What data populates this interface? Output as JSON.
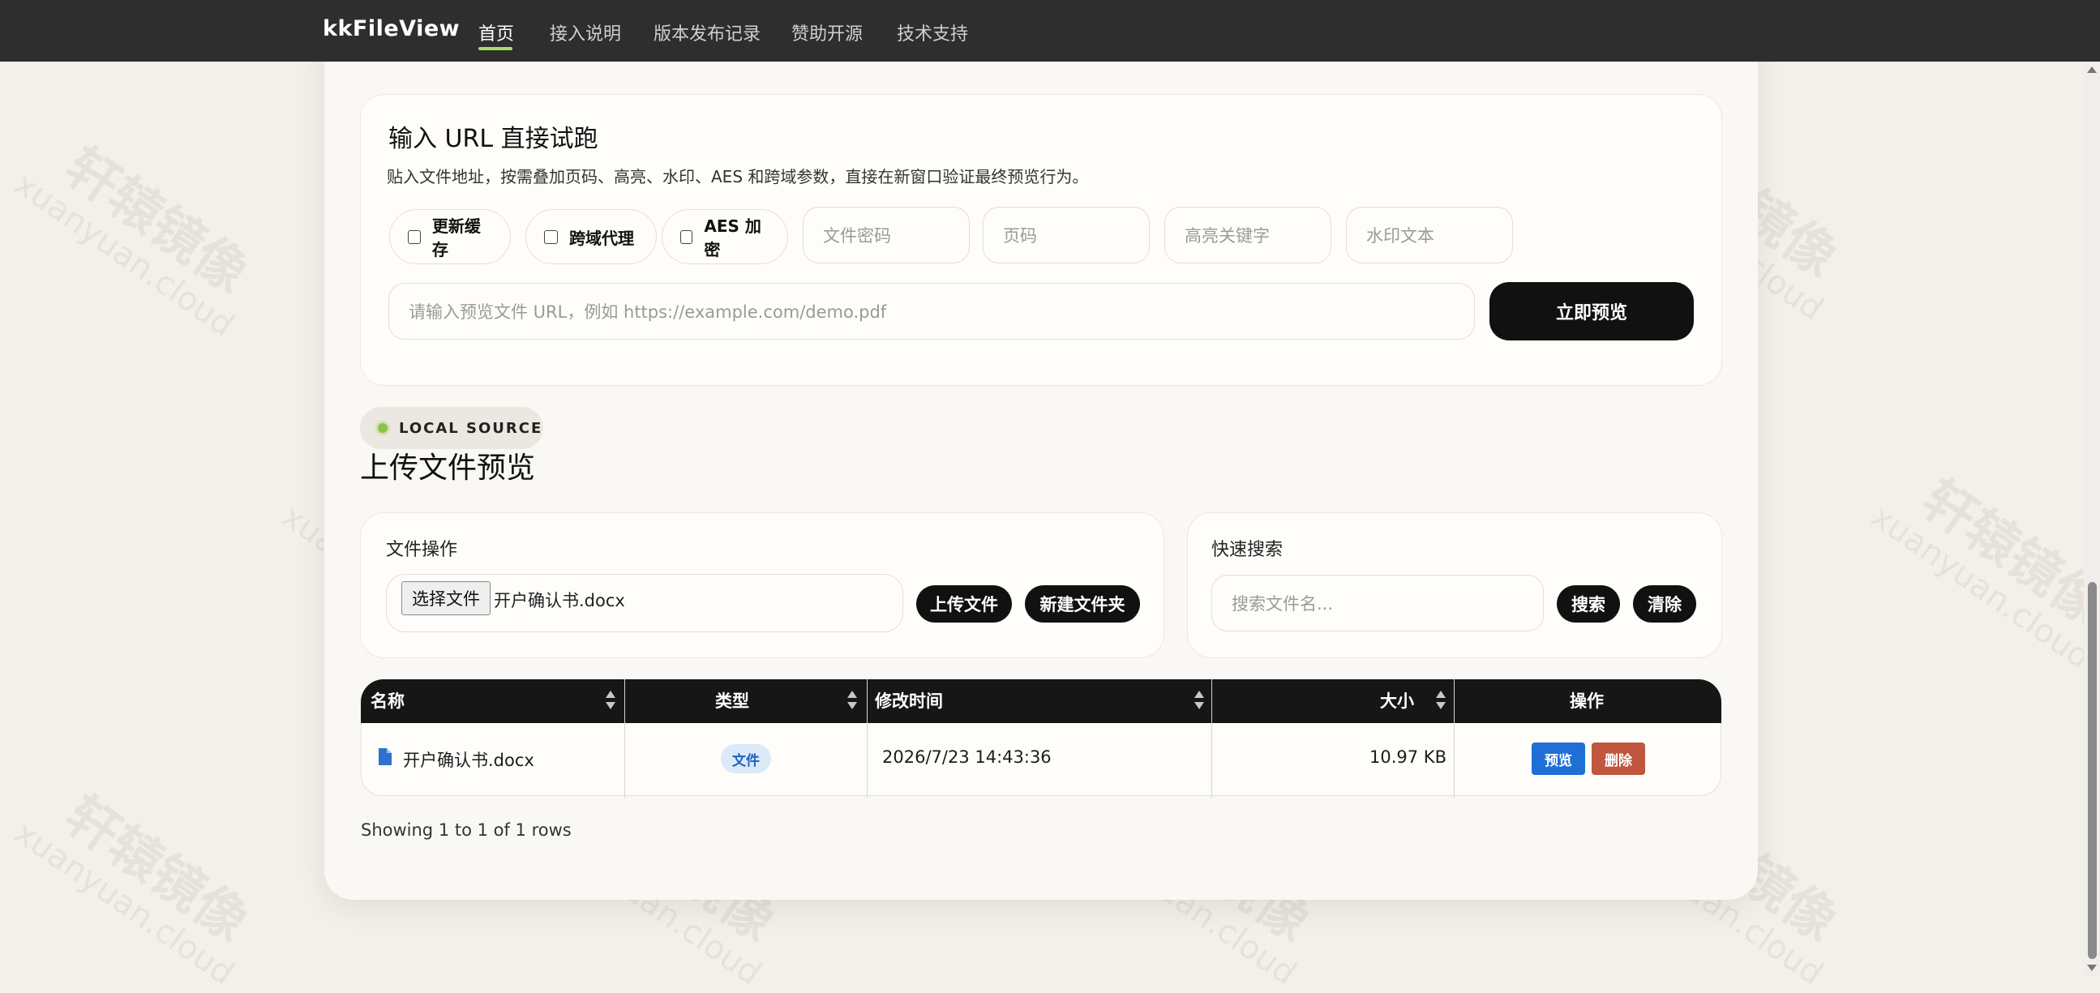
{
  "navbar": {
    "brand": "kkFileView",
    "items": [
      {
        "label": "首页",
        "active": true
      },
      {
        "label": "接入说明"
      },
      {
        "label": "版本发布记录"
      },
      {
        "label": "赞助开源"
      },
      {
        "label": "技术支持"
      }
    ]
  },
  "url_panel": {
    "title": "输入 URL 直接试跑",
    "subtitle": "贴入文件地址，按需叠加页码、高亮、水印、AES 和跨域参数，直接在新窗口验证最终预览行为。",
    "options": [
      "更新缓存",
      "跨域代理",
      "AES 加密"
    ],
    "placeholders": {
      "password": "文件密码",
      "page": "页码",
      "highlight": "高亮关键字",
      "watermark": "水印文本",
      "url": "请输入预览文件 URL，例如 https://example.com/demo.pdf"
    },
    "preview_button": "立即预览"
  },
  "upload_section": {
    "badge": "LOCAL SOURCE",
    "title": "上传文件预览",
    "file_ops": {
      "title": "文件操作",
      "choose_button": "选择文件",
      "chosen_file": "开户确认书.docx",
      "upload_button": "上传文件",
      "new_folder_button": "新建文件夹"
    },
    "search": {
      "title": "快速搜索",
      "placeholder": "搜索文件名...",
      "search_button": "搜索",
      "clear_button": "清除"
    }
  },
  "table": {
    "columns": [
      "名称",
      "类型",
      "修改时间",
      "大小",
      "操作"
    ],
    "rows": [
      {
        "name": "开户确认书.docx",
        "type": "文件",
        "modified": "2026/7/23 14:43:36",
        "size": "10.97 KB",
        "actions": [
          "预览",
          "删除"
        ]
      }
    ],
    "footer": "Showing 1 to 1 of 1 rows"
  },
  "watermark": {
    "main": "轩辕镜像",
    "sub": "xuanyuan.cloud"
  },
  "colors": {
    "accent_underline": "#a8e063",
    "preview_btn": "#1f6fd6",
    "delete_btn": "#c0563f"
  }
}
